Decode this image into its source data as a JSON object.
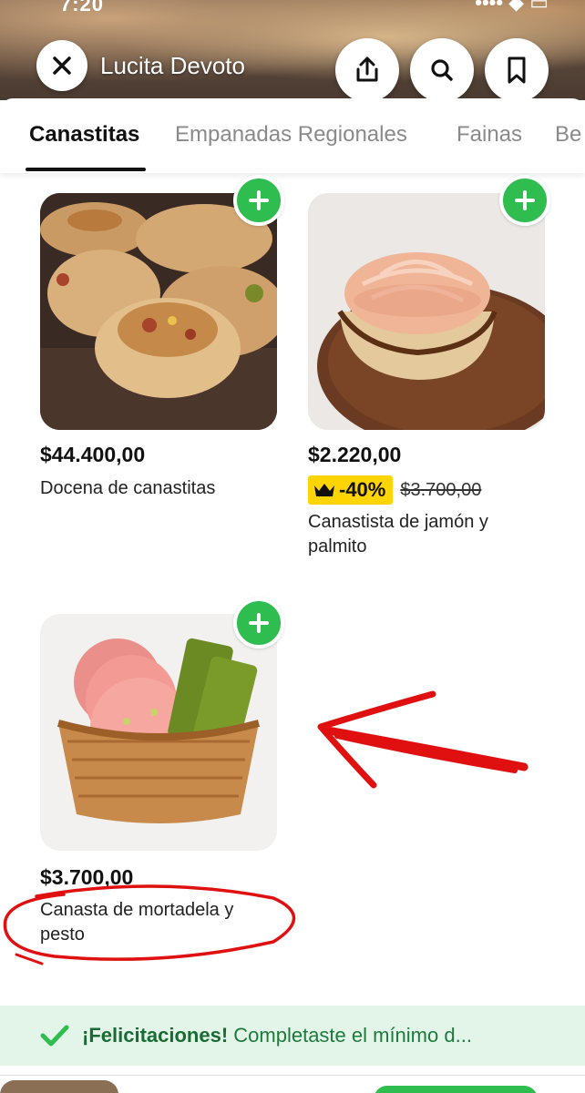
{
  "status_bar": {
    "time": "7:20"
  },
  "header": {
    "store_name": "Lucita Devoto",
    "close_icon": "close-icon",
    "share_icon": "share-icon",
    "search_icon": "search-icon",
    "bookmark_icon": "bookmark-icon"
  },
  "tabs": [
    {
      "label": "Canastitas",
      "active": true
    },
    {
      "label": "Empanadas Regionales",
      "active": false
    },
    {
      "label": "Fainas",
      "active": false
    },
    {
      "label": "Be",
      "active": false
    }
  ],
  "products": [
    {
      "name": "Docena de canastitas",
      "price": "$44.400,00"
    },
    {
      "name": "Canastista de jamón y palmito",
      "price": "$2.220,00",
      "discount": "-40%",
      "old_price": "$3.700,00",
      "discount_icon": "crown-icon"
    },
    {
      "name": "Canasta de mortadela y pesto",
      "price": "$3.700,00"
    }
  ],
  "banner": {
    "bold": "¡Felicitaciones!",
    "text": " Completaste el mínimo d..."
  },
  "colors": {
    "accent_green": "#2fbd4f",
    "discount_yellow": "#ffd400",
    "annotation_red": "#e01010",
    "banner_bg": "#e3f5e8"
  }
}
